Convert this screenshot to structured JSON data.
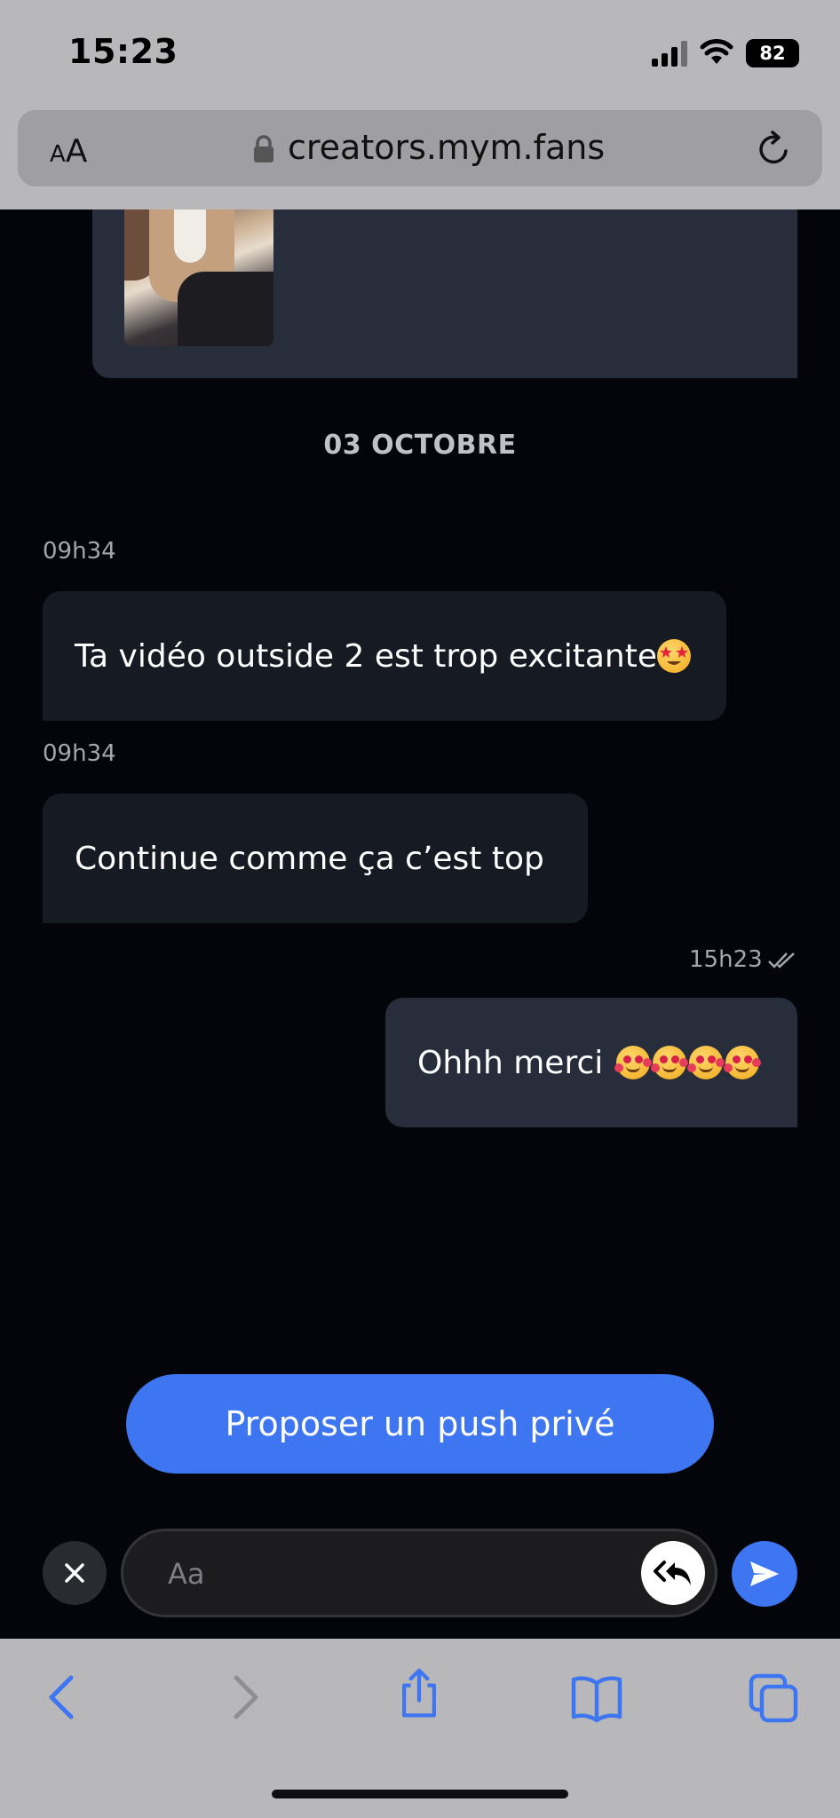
{
  "status_bar": {
    "time": "15:23",
    "battery": "82"
  },
  "browser": {
    "text_size_label": "AA",
    "url": "creators.mym.fans"
  },
  "chat": {
    "date_separator": "03 OCTOBRE",
    "messages": [
      {
        "direction": "incoming",
        "time": "09h34",
        "text": "Ta vidéo outside 2 est trop excitante",
        "emoji": [
          "star-struck-emoji"
        ]
      },
      {
        "direction": "incoming",
        "time": "09h34",
        "text": "Continue comme ça c’est top"
      },
      {
        "direction": "outgoing",
        "time": "15h23",
        "text": "Ohhh merci ",
        "emoji": [
          "smiling-face-with-hearts-emoji",
          "smiling-face-with-hearts-emoji",
          "smiling-face-with-hearts-emoji",
          "smiling-face-with-hearts-emoji"
        ],
        "read": true
      }
    ]
  },
  "actions": {
    "push_button_label": "Proposer un push privé"
  },
  "composer": {
    "placeholder": "Aa"
  },
  "colors": {
    "accent": "#3e75f0",
    "background": "#04050a",
    "bubble_in": "#151a23",
    "bubble_out": "#272d3b",
    "chrome": "#b8b8bb"
  }
}
